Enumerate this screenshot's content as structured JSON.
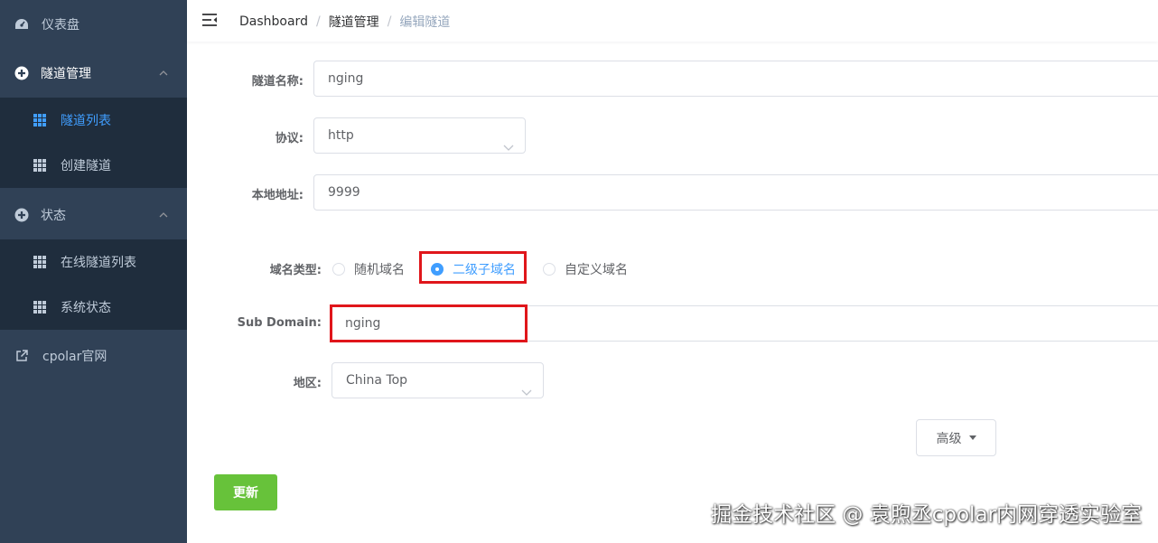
{
  "colors": {
    "sidebar_bg": "#304156",
    "submenu_bg": "#1f2d3d",
    "accent": "#409eff",
    "success": "#67c23a",
    "highlight": "#e0161b"
  },
  "sidebar": {
    "dashboard": {
      "label": "仪表盘",
      "icon": "dashboard-gauge-icon"
    },
    "tunnel_mgmt": {
      "label": "隧道管理",
      "icon": "circle-plus-icon"
    },
    "tunnel_list": {
      "label": "隧道列表",
      "icon": "grid-icon"
    },
    "create_tunnel": {
      "label": "创建隧道",
      "icon": "grid-icon"
    },
    "status": {
      "label": "状态",
      "icon": "circle-plus-icon"
    },
    "online_tunnels": {
      "label": "在线隧道列表",
      "icon": "grid-icon"
    },
    "system_status": {
      "label": "系统状态",
      "icon": "grid-icon"
    },
    "cpolar_site": {
      "label": "cpolar官网",
      "icon": "external-link-icon"
    }
  },
  "header": {
    "breadcrumb": [
      "Dashboard",
      "隧道管理",
      "编辑隧道"
    ],
    "separator": "/"
  },
  "form": {
    "name": {
      "label": "隧道名称:",
      "value": "nging"
    },
    "protocol": {
      "label": "协议:",
      "value": "http"
    },
    "local_addr": {
      "label": "本地地址:",
      "value": "9999"
    },
    "domain_type": {
      "label": "域名类型:",
      "options": [
        "随机域名",
        "二级子域名",
        "自定义域名"
      ],
      "selected": "二级子域名"
    },
    "sub_domain": {
      "label": "Sub Domain:",
      "value": "nging"
    },
    "region": {
      "label": "地区:",
      "value": "China Top"
    },
    "advanced_button": "高级",
    "update_button": "更新"
  },
  "watermark": "掘金技术社区 @ 袁煦丞cpolar内网穿透实验室"
}
